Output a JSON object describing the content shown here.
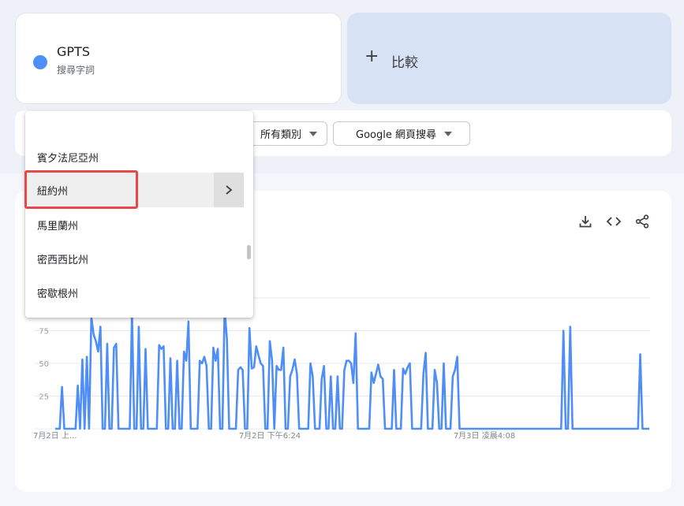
{
  "search_term": {
    "name": "GPTS",
    "type_label": "搜尋字詞",
    "color": "#4f8ef7"
  },
  "compare": {
    "icon": "plus-icon",
    "plus": "+",
    "label": "比較"
  },
  "filters": {
    "category": "所有類別",
    "category_visible": "所有類別",
    "property": "Google 網頁搜尋"
  },
  "region_dropdown": {
    "search_value": "",
    "items": [
      {
        "label": "賓夕法尼亞州",
        "visible": "partial"
      },
      {
        "label": "紐約州",
        "highlighted": true,
        "has_submenu": true
      },
      {
        "label": "馬里蘭州"
      },
      {
        "label": "密西西比州"
      },
      {
        "label": "密歇根州"
      }
    ]
  },
  "chart_tools": [
    "download-icon",
    "embed-code-icon",
    "share-icon"
  ],
  "chart_data": {
    "type": "line",
    "series": [
      {
        "color": "#4f8ef7",
        "values": [
          0,
          0,
          0,
          32,
          0,
          0,
          0,
          0,
          0,
          0,
          33,
          0,
          53,
          0,
          55,
          0,
          85,
          72,
          67,
          59,
          78,
          0,
          0,
          65,
          0,
          0,
          62,
          65,
          0,
          0,
          0,
          0,
          0,
          0,
          89,
          0,
          0,
          78,
          0,
          0,
          61,
          0,
          0,
          0,
          0,
          0,
          64,
          61,
          63,
          0,
          0,
          54,
          0,
          0,
          52,
          0,
          0,
          59,
          52,
          82,
          0,
          0,
          0,
          0,
          52,
          50,
          55,
          48,
          0,
          0,
          62,
          52,
          61,
          0,
          0,
          91,
          69,
          0,
          0,
          0,
          0,
          45,
          47,
          45,
          0,
          0,
          77,
          46,
          47,
          63,
          56,
          50,
          48,
          0,
          0,
          67,
          52,
          0,
          48,
          45,
          45,
          62,
          0,
          0,
          40,
          45,
          53,
          42,
          0,
          0,
          0,
          0,
          0,
          50,
          40,
          0,
          0,
          0,
          38,
          48,
          0,
          0,
          40,
          0,
          0,
          40,
          0,
          0,
          45,
          52,
          52,
          50,
          35,
          73,
          0,
          0,
          0,
          0,
          0,
          0,
          43,
          35,
          42,
          49,
          40,
          38,
          0,
          0,
          0,
          0,
          45,
          0,
          0,
          0,
          46,
          42,
          47,
          50,
          0,
          0,
          0,
          0,
          0,
          42,
          58,
          0,
          0,
          0,
          45,
          35,
          0,
          0,
          50,
          0,
          0,
          0,
          40,
          45,
          55,
          0,
          0,
          0,
          0,
          0,
          0,
          0,
          0,
          0,
          0,
          0,
          0,
          0,
          0,
          0,
          0,
          0,
          0,
          0,
          0,
          0,
          0,
          0,
          0,
          0,
          0,
          0,
          0,
          0,
          0,
          0,
          0,
          0,
          0,
          0,
          0,
          0,
          0,
          0,
          0,
          0,
          0,
          0,
          0,
          0,
          0,
          75,
          0,
          0,
          78,
          0,
          0,
          0,
          0,
          0,
          0,
          0,
          0,
          0,
          0,
          0,
          0,
          0,
          0,
          0,
          0,
          0,
          0,
          0,
          0,
          0,
          0,
          0,
          0,
          0,
          0,
          0,
          0,
          0,
          0,
          57,
          0,
          0,
          0,
          0
        ]
      }
    ],
    "y_ticks": [
      "25",
      "50",
      "75"
    ],
    "ylim": [
      0,
      100
    ],
    "x_ticks": [
      {
        "label": "7月2日 上...",
        "index": 0
      },
      {
        "label": "7月2日 下午6:24",
        "index": 95
      },
      {
        "label": "7月3日 凌晨4:08",
        "index": 190
      }
    ],
    "grid": true
  }
}
